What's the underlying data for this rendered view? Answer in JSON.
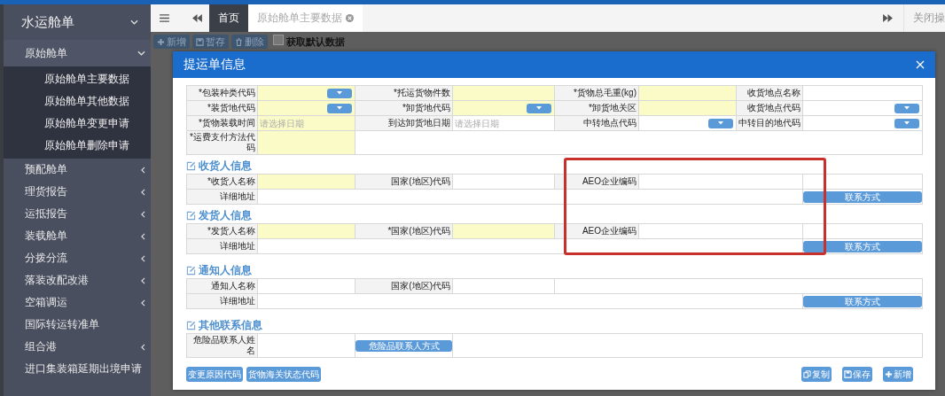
{
  "sidebar": {
    "title": "水运舱单",
    "items": [
      {
        "label": "原始舱单",
        "kind": "group",
        "expanded": true,
        "children": [
          {
            "label": "原始舱单主要数据"
          },
          {
            "label": "原始舱单其他数据"
          },
          {
            "label": "原始舱单变更申请"
          },
          {
            "label": "原始舱单删除申请"
          }
        ]
      },
      {
        "label": "预配舱单",
        "kind": "group",
        "expanded": false
      },
      {
        "label": "理货报告",
        "kind": "group",
        "expanded": false
      },
      {
        "label": "运抵报告",
        "kind": "group",
        "expanded": false
      },
      {
        "label": "装载舱单",
        "kind": "group",
        "expanded": false
      },
      {
        "label": "分拨分流",
        "kind": "group",
        "expanded": false
      },
      {
        "label": "落装改配改港",
        "kind": "group",
        "expanded": false
      },
      {
        "label": "空箱调运",
        "kind": "group",
        "expanded": false
      },
      {
        "label": "国际转运转准单",
        "kind": "link"
      },
      {
        "label": "组合港",
        "kind": "group",
        "expanded": false
      },
      {
        "label": "进口集装箱延期出境申请",
        "kind": "link"
      }
    ]
  },
  "tab_bar": {
    "tabs": [
      {
        "label": "首页",
        "selected": true,
        "closable": false
      },
      {
        "label": "原始舱单主要数据",
        "selected": false,
        "closable": true
      }
    ],
    "close_menu": "关闭操"
  },
  "toolbar": {
    "buttons": [
      {
        "label": "新增"
      },
      {
        "label": "暂存"
      },
      {
        "label": "删除"
      }
    ],
    "checkbox": {
      "label": "获取默认数据",
      "checked": false
    }
  },
  "dialog": {
    "title": "提运单信息",
    "main_rows": [
      [
        {
          "kind": "label",
          "text": "*包装种类代码"
        },
        {
          "kind": "select",
          "required": true
        },
        {
          "kind": "label",
          "text": "*托运货物件数"
        },
        {
          "kind": "input",
          "required": true
        },
        {
          "kind": "label",
          "text": "*货物总毛重(kg)"
        },
        {
          "kind": "input",
          "required": true
        },
        {
          "kind": "label",
          "text": "收货地点名称"
        },
        {
          "kind": "input",
          "required": false
        }
      ],
      [
        {
          "kind": "label",
          "text": "*装货地代码"
        },
        {
          "kind": "select",
          "required": true
        },
        {
          "kind": "label",
          "text": "*卸货地代码"
        },
        {
          "kind": "select",
          "required": true
        },
        {
          "kind": "label",
          "text": "*卸货地关区"
        },
        {
          "kind": "input",
          "required": true
        },
        {
          "kind": "label",
          "text": "收货地点代码"
        },
        {
          "kind": "select",
          "required": false
        }
      ],
      [
        {
          "kind": "label",
          "text": "*货物装载时间"
        },
        {
          "kind": "date",
          "required": true,
          "placeholder": "请选择日期"
        },
        {
          "kind": "label",
          "text": "到达卸货地日期"
        },
        {
          "kind": "date",
          "required": false,
          "placeholder": "请选择日期"
        },
        {
          "kind": "label",
          "text": "中转地点代码"
        },
        {
          "kind": "select",
          "required": false
        },
        {
          "kind": "label",
          "text": "中转目的地代码"
        },
        {
          "kind": "select",
          "required": false
        }
      ],
      [
        {
          "kind": "label",
          "text": "*运费支付方法代码"
        },
        {
          "kind": "input",
          "required": true
        },
        {
          "kind": "empty"
        }
      ]
    ],
    "sections": [
      {
        "title": "收货人信息",
        "rows": [
          [
            {
              "kind": "label",
              "text": "*收货人名称"
            },
            {
              "kind": "input",
              "required": true
            },
            {
              "kind": "label",
              "text": "国家(地区)代码"
            },
            {
              "kind": "input",
              "required": false
            },
            {
              "kind": "label",
              "text": "AEO企业编码"
            },
            {
              "kind": "input",
              "required": false
            },
            {
              "kind": "spacer"
            }
          ],
          [
            {
              "kind": "label",
              "text": "详细地址"
            },
            {
              "kind": "input",
              "required": false
            },
            {
              "kind": "button",
              "text": "联系方式"
            }
          ]
        ]
      },
      {
        "title": "发货人信息",
        "rows": [
          [
            {
              "kind": "label",
              "text": "*发货人名称"
            },
            {
              "kind": "input",
              "required": true
            },
            {
              "kind": "label",
              "text": "*国家(地区)代码"
            },
            {
              "kind": "input",
              "required": true
            },
            {
              "kind": "label",
              "text": "AEO企业编码"
            },
            {
              "kind": "input",
              "required": false
            },
            {
              "kind": "spacer"
            }
          ],
          [
            {
              "kind": "label",
              "text": "详细地址"
            },
            {
              "kind": "input",
              "required": false
            },
            {
              "kind": "button",
              "text": "联系方式"
            }
          ]
        ]
      },
      {
        "title": "通知人信息",
        "rows": [
          [
            {
              "kind": "label",
              "text": "通知人名称"
            },
            {
              "kind": "input",
              "required": false
            },
            {
              "kind": "label",
              "text": "国家(地区)代码"
            },
            {
              "kind": "input",
              "required": false
            },
            {
              "kind": "empty"
            }
          ],
          [
            {
              "kind": "label",
              "text": "详细地址"
            },
            {
              "kind": "input",
              "required": false
            },
            {
              "kind": "button",
              "text": "联系方式"
            }
          ]
        ]
      },
      {
        "title": "其他联系信息",
        "rows": [
          [
            {
              "kind": "label",
              "text": "危险品联系人姓名"
            },
            {
              "kind": "input",
              "required": false
            },
            {
              "kind": "button",
              "text": "危险品联系人方式"
            },
            {
              "kind": "empty"
            }
          ]
        ]
      }
    ],
    "footer_left": [
      {
        "label": "变更原因代码"
      },
      {
        "label": "货物海关状态代码"
      }
    ],
    "footer_right": [
      {
        "label": "复制"
      },
      {
        "label": "保存"
      },
      {
        "label": "新增"
      }
    ]
  }
}
